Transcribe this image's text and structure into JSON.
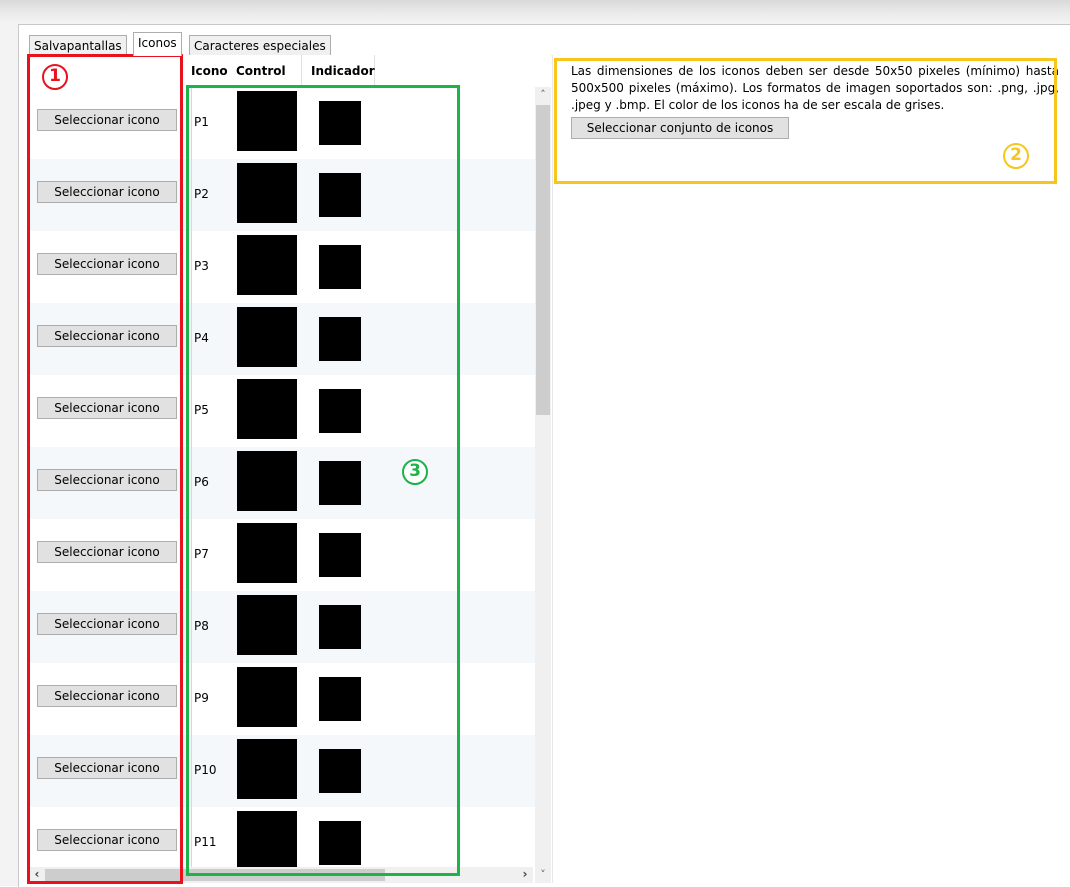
{
  "tabs": [
    {
      "label": "Salvapantallas",
      "active": false
    },
    {
      "label": "Iconos",
      "active": true
    },
    {
      "label": "Caracteres especiales",
      "active": false
    }
  ],
  "grid": {
    "columns": {
      "icono": "Icono",
      "control": "Control",
      "indicador": "Indicador"
    },
    "select_button_label": "Seleccionar icono",
    "rows": [
      {
        "label": "P1"
      },
      {
        "label": "P2"
      },
      {
        "label": "P3"
      },
      {
        "label": "P4"
      },
      {
        "label": "P5"
      },
      {
        "label": "P6"
      },
      {
        "label": "P7"
      },
      {
        "label": "P8"
      },
      {
        "label": "P9"
      },
      {
        "label": "P10"
      },
      {
        "label": "P11"
      }
    ]
  },
  "info": {
    "text": "Las dimensiones de los iconos deben ser desde 50x50 pixeles (mínimo) hasta 500x500 pixeles (máximo). Los formatos de imagen soportados son: .png, .jpg, .jpeg y .bmp. El color de los iconos ha de ser escala de grises.",
    "set_button_label": "Seleccionar conjunto de iconos"
  },
  "annotations": {
    "one": "1",
    "two": "2",
    "three": "3"
  },
  "colors": {
    "annotation_red": "#e8121e",
    "annotation_green": "#1bb34a",
    "annotation_yellow": "#f6c61c"
  }
}
